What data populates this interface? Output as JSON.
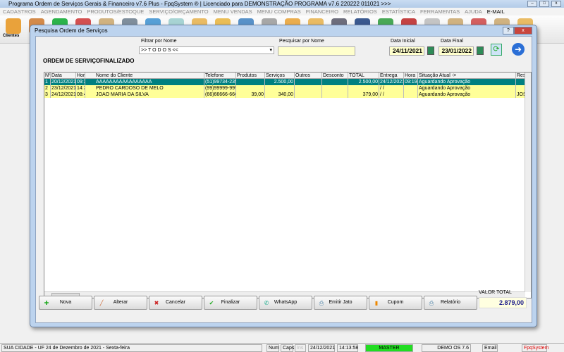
{
  "window": {
    "title": "Programa Ordem de Serviços Gerais & Financeiro v7.6 Plus - FpqSystem ® | Licenciado para  DEMONSTRAÇÃO PROGRAMA v7.6 220222 011021 >>>"
  },
  "menu": [
    "CADASTROS",
    "AGENDAMENTO",
    "PRODUTOS/ESTOQUE",
    "SERVIÇO/ORÇAMENTO",
    "MENU VENDAS",
    "MENU COMPRAS",
    "FINANCEIRO",
    "RELATÓRIOS",
    "ESTATÍSTICA",
    "FERRAMENTAS",
    "AJUDA",
    "E-MAIL"
  ],
  "toolbar": {
    "clientes_label": "Clientes"
  },
  "dialog": {
    "title": "Pesquisa Ordem de Serviços",
    "help": "?",
    "close": "x",
    "header": {
      "ordem": "ORDEM DE SERVIÇO",
      "finalizado": "FINALIZADO",
      "filtrar_label": "Filtrar por Nome",
      "filtrar_value": ">> T O D O S <<",
      "pesquisar_label": "Pesquisar por Nome",
      "pesquisar_value": "",
      "data_inicial_label": "Data Inicial",
      "data_inicial": "24/11/2021",
      "data_final_label": "Data Final",
      "data_final": "23/01/2022"
    },
    "columns": [
      "Nº",
      "Data",
      "Hora",
      "Nome do Cliente",
      "Telefone",
      "Produtos",
      "Serviços",
      "Outros",
      "Desconto",
      "TOTAL",
      "Entrega",
      "Hora",
      "Situação Atual ->",
      "Res"
    ],
    "rows": [
      [
        "1",
        "20/12/2021",
        "09:36",
        "AAAAAAAAAAAAAAAAA",
        "(51)99734-2390",
        "",
        "2.500,00",
        "",
        "",
        "2.500,00",
        "24/12/2021",
        "09:19",
        "Aguardando Aprovação",
        ""
      ],
      [
        "2",
        "23/12/2021",
        "14:31",
        "PEDRO CARDOSO DE MELO",
        "(99)99999-9999",
        "",
        "",
        "",
        "",
        "",
        "/ /",
        "",
        "Aguardando Aprovação",
        ""
      ],
      [
        "3",
        "24/12/2021",
        "08:47",
        "JOAO MARIA DA SILVA",
        "(66)66666-6666",
        "39,00",
        "340,00",
        "",
        "",
        "379,00",
        "/ /",
        "",
        "Aguardando Aprovação",
        "JOSI"
      ]
    ],
    "buttons": [
      "Nova",
      "Alterar",
      "Cancelar",
      "Finalizar",
      "WhatsApp",
      "Emitir Jato",
      "Cupom",
      "Relatório"
    ],
    "valor_total_label": "VALOR TOTAL",
    "valor_total": "2.879,00"
  },
  "status": {
    "city": "SUA CIDADE - UF 24 de Dezembro de 2021 - Sexta-feira",
    "num": "Num",
    "caps": "Caps",
    "ins": "Ins",
    "date": "24/12/2021",
    "time": "14:13:58",
    "user": "MASTER",
    "version": "DEMO OS 7.6",
    "email": "Email",
    "brand": "FpqSystem"
  },
  "colors": {
    "selected_row": "#008080",
    "row_highlight": "#ffff99",
    "master": "#22dd22",
    "brand": "#dd0000"
  }
}
